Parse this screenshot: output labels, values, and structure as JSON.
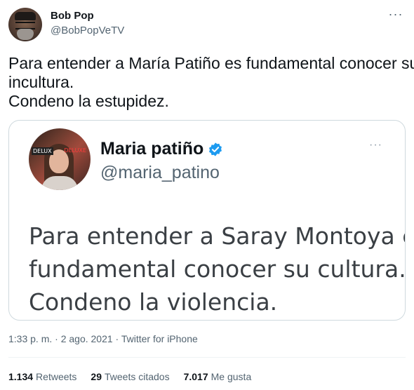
{
  "author": {
    "name": "Bob Pop",
    "handle": "@BobPopVeTV"
  },
  "tweet": {
    "lines": [
      "Para entender a María Patiño es fundamental conocer su",
      "incultura.",
      "Condeno la estupidez."
    ]
  },
  "embed": {
    "name": "Maria patiño",
    "handle": "@maria_patino",
    "avatar_logos": [
      "DELUX",
      "DELUXE"
    ],
    "lines": [
      "Para entender a Saray Montoya es",
      "fundamental conocer su cultura.",
      "Condeno la violencia."
    ],
    "verified_color": "#1d9bf0"
  },
  "meta": {
    "timestamp": "1:33 p. m. · 2 ago. 2021 · Twitter for iPhone"
  },
  "stats": {
    "retweets_count": "1.134",
    "retweets_label": "Retweets",
    "quotes_count": "29",
    "quotes_label": "Tweets citados",
    "likes_count": "7.017",
    "likes_label": "Me gusta"
  },
  "icons": {
    "more": "more-options-icon",
    "verified": "verified-badge-icon"
  }
}
